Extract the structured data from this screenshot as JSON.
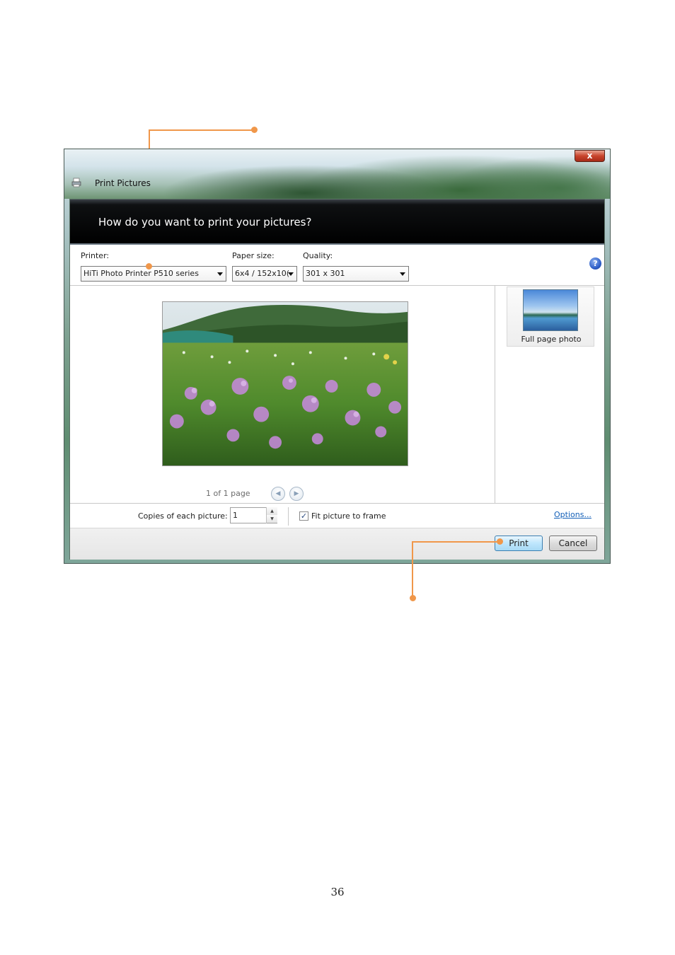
{
  "window": {
    "title": "Print Pictures",
    "close_label": "x",
    "header": "How do you want to print your pictures?"
  },
  "printer": {
    "label": "Printer:",
    "value": "HiTi Photo Printer P510 series"
  },
  "paper_size": {
    "label": "Paper size:",
    "value": "6x4 / 152x10("
  },
  "quality": {
    "label": "Quality:",
    "value": "301 x 301"
  },
  "help": {
    "glyph": "?"
  },
  "preview": {
    "page_status": "1 of 1 page",
    "prev_glyph": "◀",
    "next_glyph": "▶"
  },
  "layouts": [
    {
      "label": "Full page photo",
      "selected": true
    }
  ],
  "copies": {
    "label": "Copies of each picture:",
    "value": "1"
  },
  "fit": {
    "label": "Fit picture to frame",
    "checked": true,
    "check_glyph": "✓"
  },
  "options_link": "Options...",
  "buttons": {
    "print": "Print",
    "cancel": "Cancel"
  },
  "document": {
    "page_number": "36"
  },
  "colors": {
    "callout": "#f0974a",
    "header_band": "#000000",
    "link": "#1460b8"
  }
}
